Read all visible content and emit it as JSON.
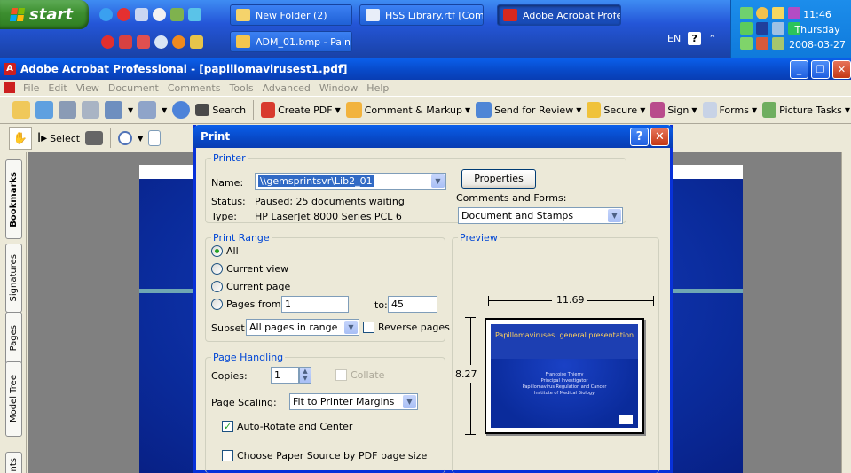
{
  "taskbar": {
    "start_label": "start",
    "tasks": [
      {
        "label": "New Folder (2)"
      },
      {
        "label": "HSS Library.rtf [Com..."
      },
      {
        "label": "Adobe Acrobat Profe..."
      },
      {
        "label": "ADM_01.bmp - Paint"
      }
    ],
    "lang": "EN",
    "help": "?",
    "time": "11:46",
    "day": "Thursday",
    "date": "2008-03-27"
  },
  "window": {
    "title": "Adobe Acrobat Professional - [papillomavirusest1.pdf]",
    "menu": [
      "File",
      "Edit",
      "View",
      "Document",
      "Comments",
      "Tools",
      "Advanced",
      "Window",
      "Help"
    ],
    "toolbar": {
      "search": "Search",
      "create_pdf": "Create PDF",
      "comment_markup": "Comment & Markup",
      "send_review": "Send for Review",
      "secure": "Secure",
      "sign": "Sign",
      "forms": "Forms",
      "picture_tasks": "Picture Tasks",
      "select": "Select"
    },
    "side_tabs": [
      "Bookmarks",
      "Signatures",
      "Pages",
      "Model Tree",
      "nts"
    ]
  },
  "dialog": {
    "title": "Print",
    "printer": {
      "legend": "Printer",
      "name_label": "Name:",
      "name_value": "\\\\gemsprintsvr\\Lib2_01",
      "status_label": "Status:",
      "status_value": "Paused; 25 documents waiting",
      "type_label": "Type:",
      "type_value": "HP LaserJet 8000 Series PCL 6",
      "properties": "Properties",
      "comments_label": "Comments and Forms:",
      "comments_value": "Document and Stamps"
    },
    "range": {
      "legend": "Print Range",
      "all": "All",
      "current_view": "Current view",
      "current_page": "Current page",
      "pages_from": "Pages  from:",
      "from_value": "1",
      "to_label": "to:",
      "to_value": "45",
      "subset_label": "Subset:",
      "subset_value": "All pages in range",
      "reverse": "Reverse pages"
    },
    "handling": {
      "legend": "Page Handling",
      "copies_label": "Copies:",
      "copies_value": "1",
      "collate": "Collate",
      "scaling_label": "Page Scaling:",
      "scaling_value": "Fit to Printer Margins",
      "auto_rotate": "Auto-Rotate and Center",
      "paper_source": "Choose Paper Source by PDF page size"
    },
    "preview": {
      "legend": "Preview",
      "width": "11.69",
      "height": "8.27",
      "slide_title": "Papillomaviruses: general presentation",
      "slide_lines": [
        "Françoise Thierry",
        "Principal Investigator",
        "Papillomavirus Regulation and Cancer",
        "Institute of Medical Biology"
      ]
    }
  }
}
